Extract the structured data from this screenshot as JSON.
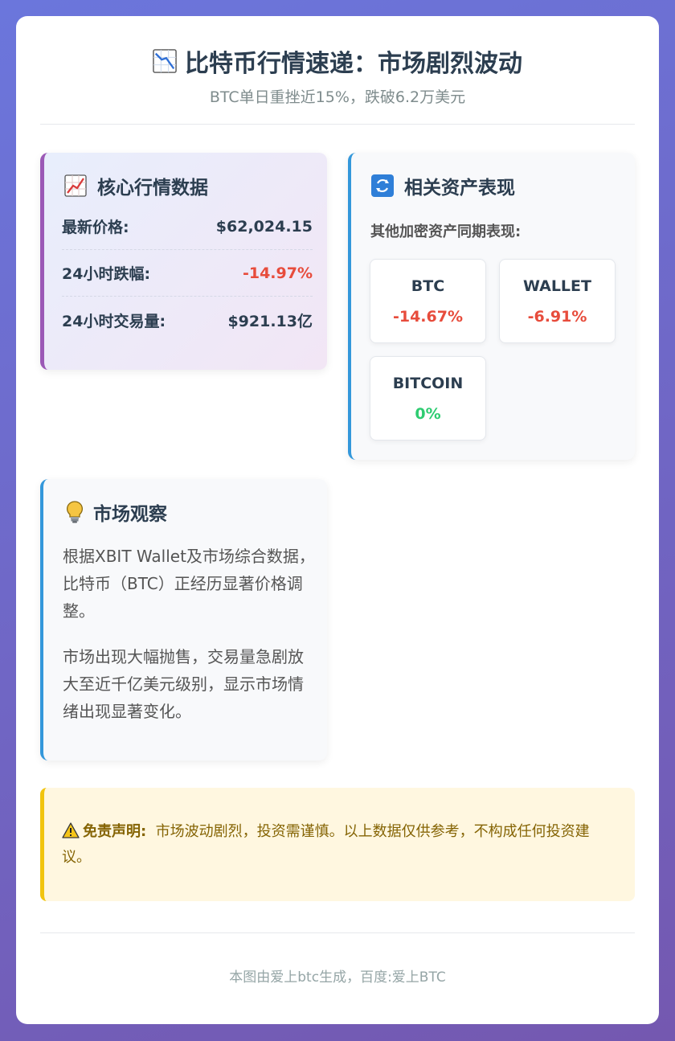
{
  "header": {
    "title": "比特币行情速递：市场剧烈波动",
    "subtitle": "BTC单日重挫近15%，跌破6.2万美元",
    "title_icon": "chart-down-icon"
  },
  "market": {
    "title": "核心行情数据",
    "title_icon": "chart-up-icon",
    "rows": [
      {
        "label": "最新价格:",
        "value": "$62,024.15"
      },
      {
        "label": "24小时跌幅:",
        "value": "-14.97%"
      },
      {
        "label": "24小时交易量:",
        "value": "$921.13亿"
      }
    ]
  },
  "assets": {
    "title": "相关资产表现",
    "title_icon": "refresh-icon",
    "subtitle": "其他加密资产同期表现:",
    "items": [
      {
        "name": "BTC",
        "change": "-14.67%"
      },
      {
        "name": "WALLET",
        "change": "-6.91%"
      },
      {
        "name": "BITCOIN",
        "change": "0%"
      }
    ]
  },
  "observation": {
    "title": "市场观察",
    "title_icon": "lightbulb-icon",
    "paragraphs": [
      "根据XBIT Wallet及市场综合数据，比特币（BTC）正经历显著价格调整。",
      "市场出现大幅抛售，交易量急剧放大至近千亿美元级别，显示市场情绪出现显著变化。"
    ]
  },
  "disclaimer": {
    "icon": "warning-icon",
    "label": "免责声明:",
    "text": "市场波动剧烈，投资需谨慎。以上数据仅供参考，不构成任何投资建议。"
  },
  "footer": {
    "text": "本图由爱上btc生成，百度:爱上BTC"
  },
  "colors": {
    "negative": "#e74c3c",
    "positive": "#2ecc71",
    "accent_purple": "#9b59b6",
    "accent_blue": "#3498db",
    "warning": "#f1c40f"
  }
}
